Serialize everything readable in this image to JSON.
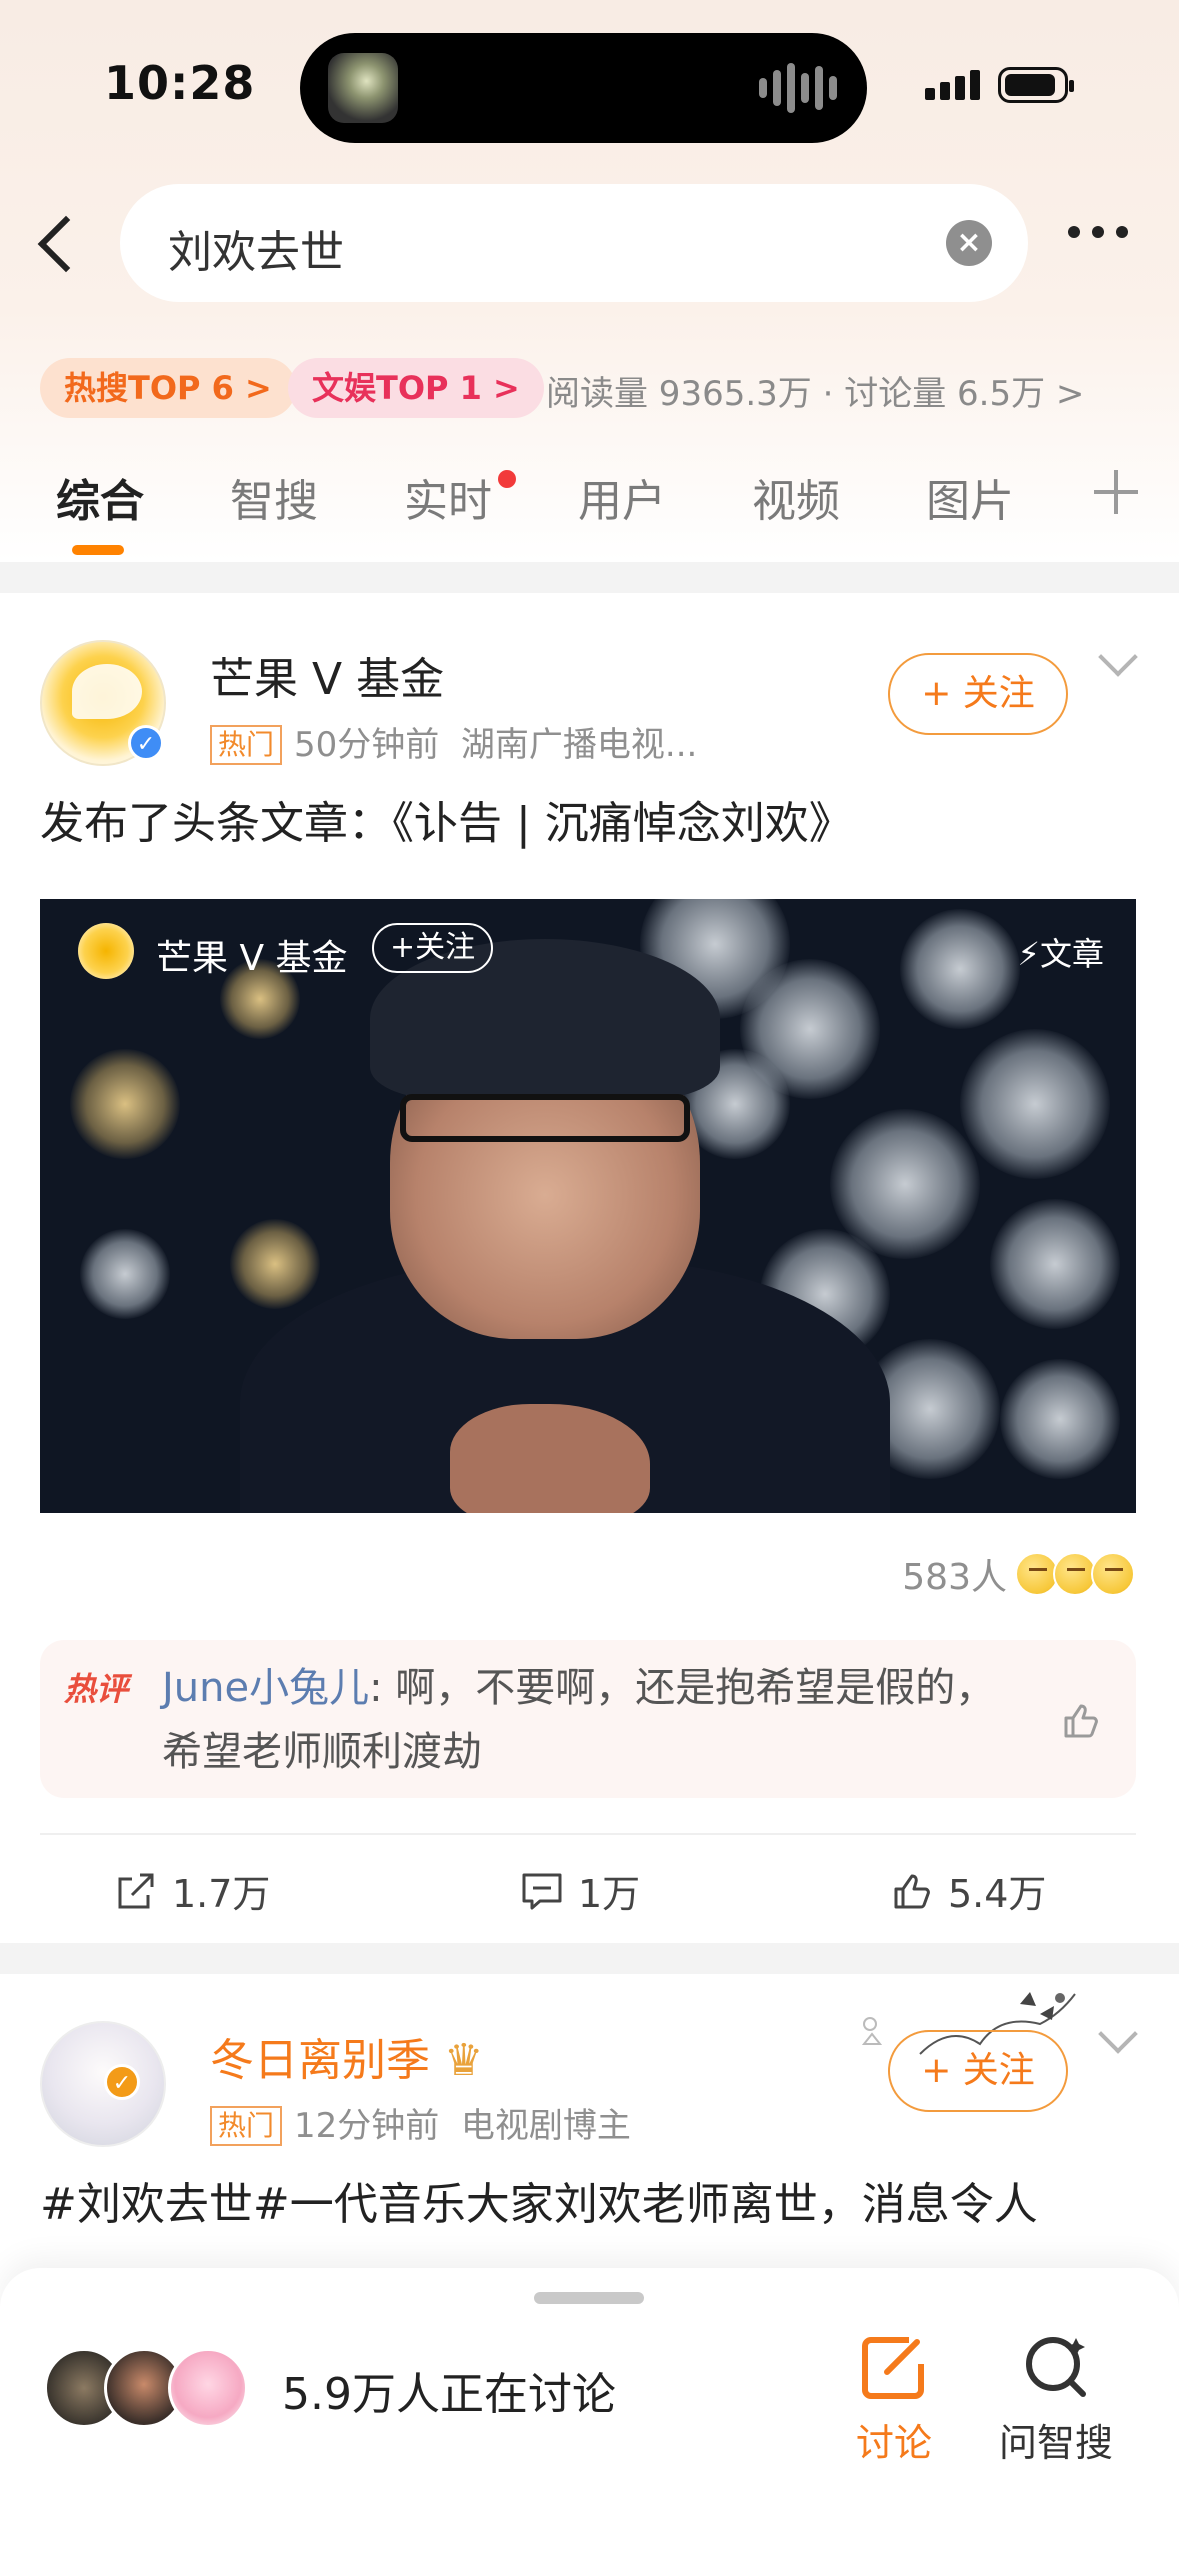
{
  "status": {
    "time": "10:28"
  },
  "search": {
    "query": "刘欢去世"
  },
  "topic": {
    "hot_tag": "热搜TOP 6 >",
    "ent_tag": "文娱TOP 1 >",
    "stats": "阅读量 9365.3万 · 讨论量 6.5万 >"
  },
  "tabs": [
    {
      "label": "综合",
      "active": true
    },
    {
      "label": "智搜"
    },
    {
      "label": "实时"
    },
    {
      "label": "用户"
    },
    {
      "label": "视频"
    },
    {
      "label": "图片"
    }
  ],
  "post1": {
    "username": "芒果 V 基金",
    "hot_label": "热门",
    "time": "50分钟前",
    "source": "湖南广播电视...",
    "follow": "+ 关注",
    "text": "发布了头条文章：《讣告 | 沉痛悼念刘欢》",
    "media": {
      "name": "芒果 V 基金",
      "follow": "+关注",
      "type": "⚡文章"
    },
    "reactions_count": "583人",
    "hot_comment": {
      "tag": "热评",
      "user": "June小兔儿",
      "text": ": 啊，不要啊，还是抱希望是假的，希望老师顺利渡劫"
    },
    "actions": {
      "share": "1.7万",
      "comment": "1万",
      "like": "5.4万"
    }
  },
  "post2": {
    "username": "冬日离别季",
    "hot_label": "热门",
    "time": "12分钟前",
    "source": "电视剧博主",
    "follow": "+ 关注",
    "text": "#刘欢去世#一代音乐大家刘欢老师离世，消息令人"
  },
  "bottom": {
    "discussing": "5.9万人正在讨论",
    "discuss_btn": "讨论",
    "ask_btn": "问智搜"
  },
  "colors": {
    "accent": "#ff8200",
    "hot_orange": "#f2691c",
    "ent_red": "#e8315a",
    "link_blue": "#5c7db0"
  }
}
